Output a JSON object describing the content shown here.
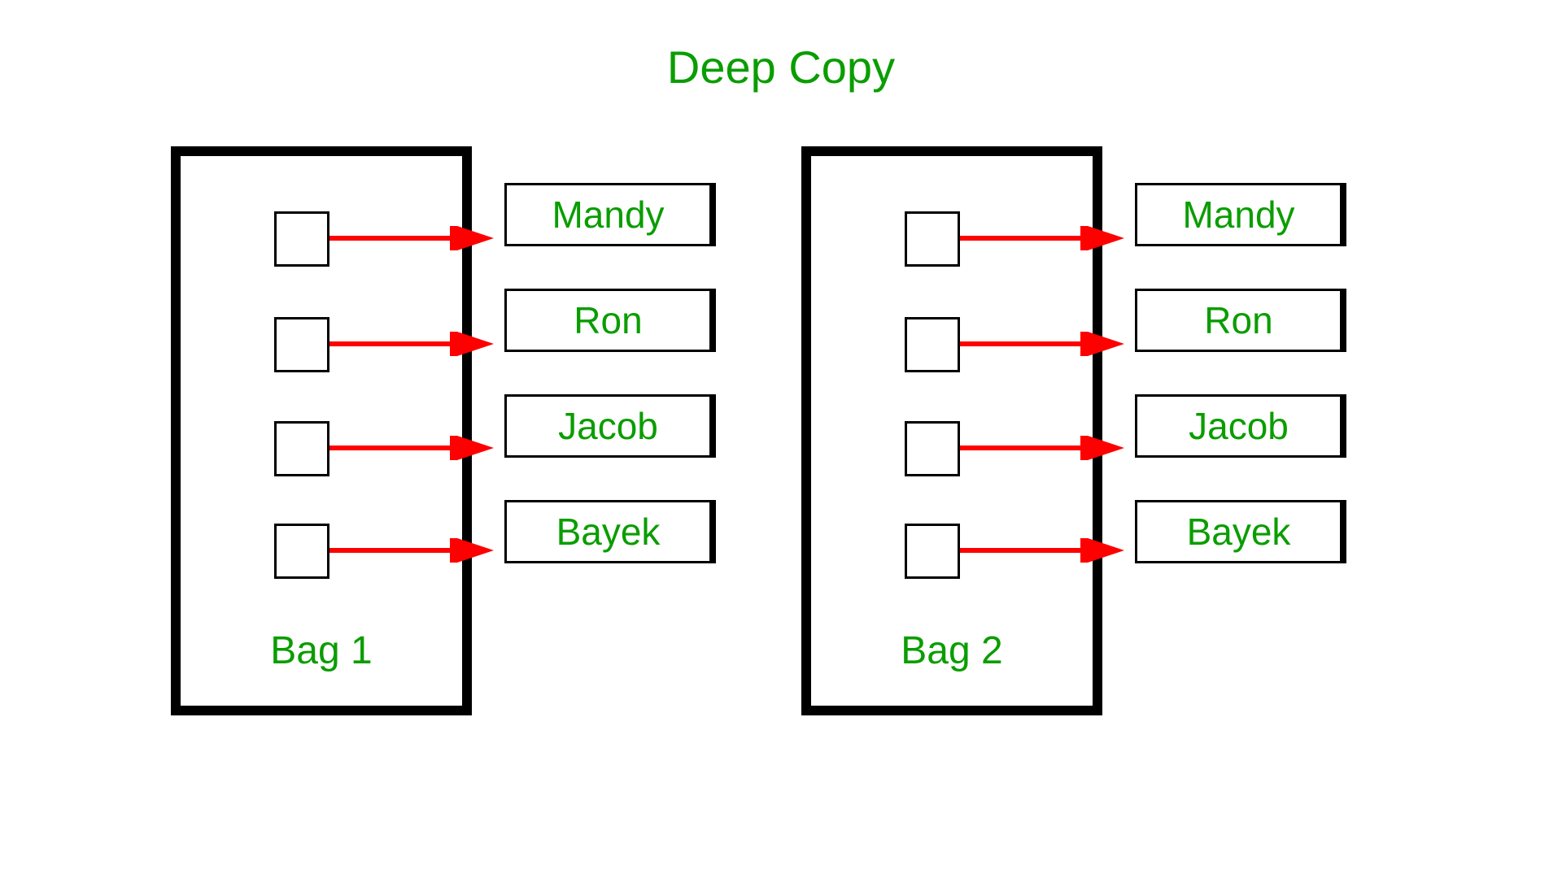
{
  "title": "Deep Copy",
  "bags": [
    {
      "label": "Bag 1"
    },
    {
      "label": "Bag 2"
    }
  ],
  "names": [
    "Mandy",
    "Ron",
    "Jacob",
    "Bayek"
  ],
  "colors": {
    "text": "#0a9d00",
    "arrow": "#ff0000",
    "border": "#000000"
  }
}
